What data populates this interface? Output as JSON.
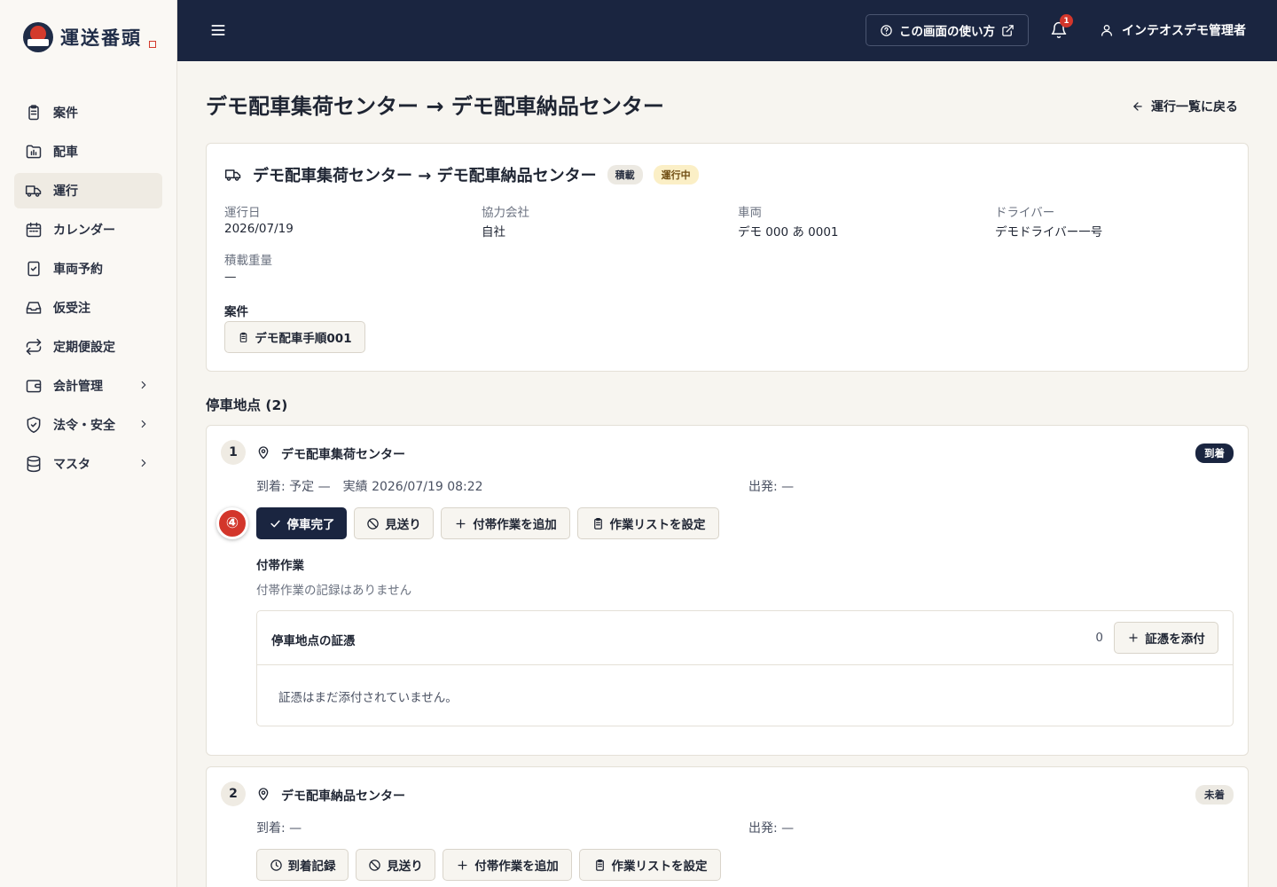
{
  "app": {
    "logo_text": "運送番頭"
  },
  "sidebar": {
    "items": [
      {
        "label": "案件",
        "icon": "clipboard-icon"
      },
      {
        "label": "配車",
        "icon": "folder-chart-icon"
      },
      {
        "label": "運行",
        "icon": "truck-icon",
        "active": true
      },
      {
        "label": "カレンダー",
        "icon": "calendar-icon"
      },
      {
        "label": "車両予約",
        "icon": "clipboard-check-icon"
      },
      {
        "label": "仮受注",
        "icon": "inbox-icon"
      },
      {
        "label": "定期便設定",
        "icon": "repeat-icon"
      },
      {
        "label": "会計管理",
        "icon": "wallet-icon",
        "has_children": true
      },
      {
        "label": "法令・安全",
        "icon": "shield-check-icon",
        "has_children": true
      },
      {
        "label": "マスタ",
        "icon": "database-icon",
        "has_children": true
      }
    ]
  },
  "header": {
    "help_label": "この画面の使い方",
    "notification_count": "1",
    "user_name": "インテオスデモ管理者"
  },
  "page": {
    "title": "デモ配車集荷センター → デモ配車納品センター",
    "back_label": "運行一覧に戻る"
  },
  "trip": {
    "title": "デモ配車集荷センター → デモ配車納品センター",
    "badge_loading": "積載",
    "badge_status": "運行中",
    "fields": {
      "date_label": "運行日",
      "date_value": "2026/07/19",
      "partner_label": "協力会社",
      "partner_value": "自社",
      "vehicle_label": "車両",
      "vehicle_value": "デモ 000 あ 0001",
      "driver_label": "ドライバー",
      "driver_value": "デモドライバー一号",
      "weight_label": "積載重量",
      "weight_value": "—"
    },
    "anken_label": "案件",
    "anken_chip": "デモ配車手順001"
  },
  "stops": {
    "section_title": "停車地点 (2)",
    "step_marker": "④",
    "stop1": {
      "number": "1",
      "name": "デモ配車集荷センター",
      "status": "到着",
      "arrival": "到着: 予定 —　実績 2026/07/19 08:22",
      "departure": "出発: —",
      "buttons": {
        "complete": "停車完了",
        "skip": "見送り",
        "add_task": "付帯作業を追加",
        "set_list": "作業リストを設定"
      },
      "sub_title": "付帯作業",
      "sub_empty": "付帯作業の記録はありません",
      "evidence": {
        "title": "停車地点の証憑",
        "count": "0",
        "add_label": "証憑を添付",
        "empty": "証憑はまだ添付されていません。"
      }
    },
    "stop2": {
      "number": "2",
      "name": "デモ配車納品センター",
      "status": "未着",
      "arrival": "到着: —",
      "departure": "出発: —",
      "buttons": {
        "arrive": "到着記録",
        "skip": "見送り",
        "add_task": "付帯作業を追加",
        "set_list": "作業リストを設定"
      }
    }
  }
}
